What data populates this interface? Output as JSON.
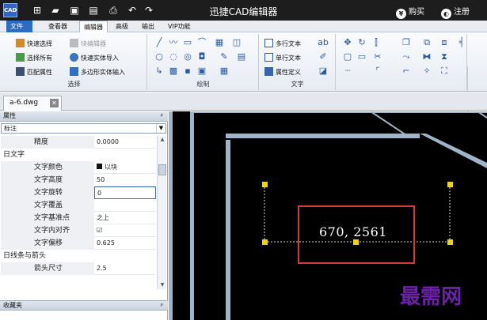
{
  "titlebar": {
    "app_title": "迅捷CAD编辑器",
    "logo_text": "CAD",
    "buy_label": "购买",
    "register_label": "注册",
    "quick_access_icons": [
      "new-icon",
      "open-icon",
      "save-icon",
      "save-as-icon",
      "print-icon",
      "undo-icon",
      "redo-icon"
    ]
  },
  "menubar": {
    "items": [
      "文件",
      "查看器",
      "编辑器",
      "高级",
      "输出",
      "VIP功能"
    ],
    "active": "编辑器"
  },
  "ribbon": {
    "select_group": {
      "label": "选择",
      "buttons": [
        "快速选择",
        "块编辑器",
        "选择所有",
        "快速实体导入",
        "匹配属性",
        "多边形实体输入"
      ]
    },
    "draw_group": {
      "label": "绘制"
    },
    "text_group": {
      "label": "文字",
      "buttons": [
        "多行文本",
        "单行文本",
        "属性定义"
      ]
    }
  },
  "document_tab": {
    "name": "a-6.dwg"
  },
  "properties": {
    "header": "属性",
    "pin_glyph": "ᵖ",
    "selected_type": "标注",
    "rows": [
      {
        "key": "精度",
        "value": "0.0000",
        "type": "field"
      },
      {
        "key": "日文字",
        "value": "",
        "type": "category"
      },
      {
        "key": "文字颜色",
        "value": "以块",
        "type": "color"
      },
      {
        "key": "文字高度",
        "value": "50",
        "type": "field"
      },
      {
        "key": "文字旋转",
        "value": "0",
        "type": "selected"
      },
      {
        "key": "文字覆盖",
        "value": "",
        "type": "field"
      },
      {
        "key": "文字基准点",
        "value": "之上",
        "type": "field"
      },
      {
        "key": "文字内对齐",
        "value": "☑",
        "type": "check"
      },
      {
        "key": "文字偏移",
        "value": "0.625",
        "type": "field"
      },
      {
        "key": "日线条与箭头",
        "value": "",
        "type": "category"
      },
      {
        "key": "箭头尺寸",
        "value": "2.5",
        "type": "field"
      }
    ],
    "favorites_header": "收藏夹"
  },
  "canvas": {
    "dimension_text": "670, 2561",
    "watermark": "最需网",
    "colors": {
      "background": "#000000",
      "wall": "#9fb4c8",
      "grips": "#f2d400",
      "highlight": "#d43a3a"
    }
  }
}
